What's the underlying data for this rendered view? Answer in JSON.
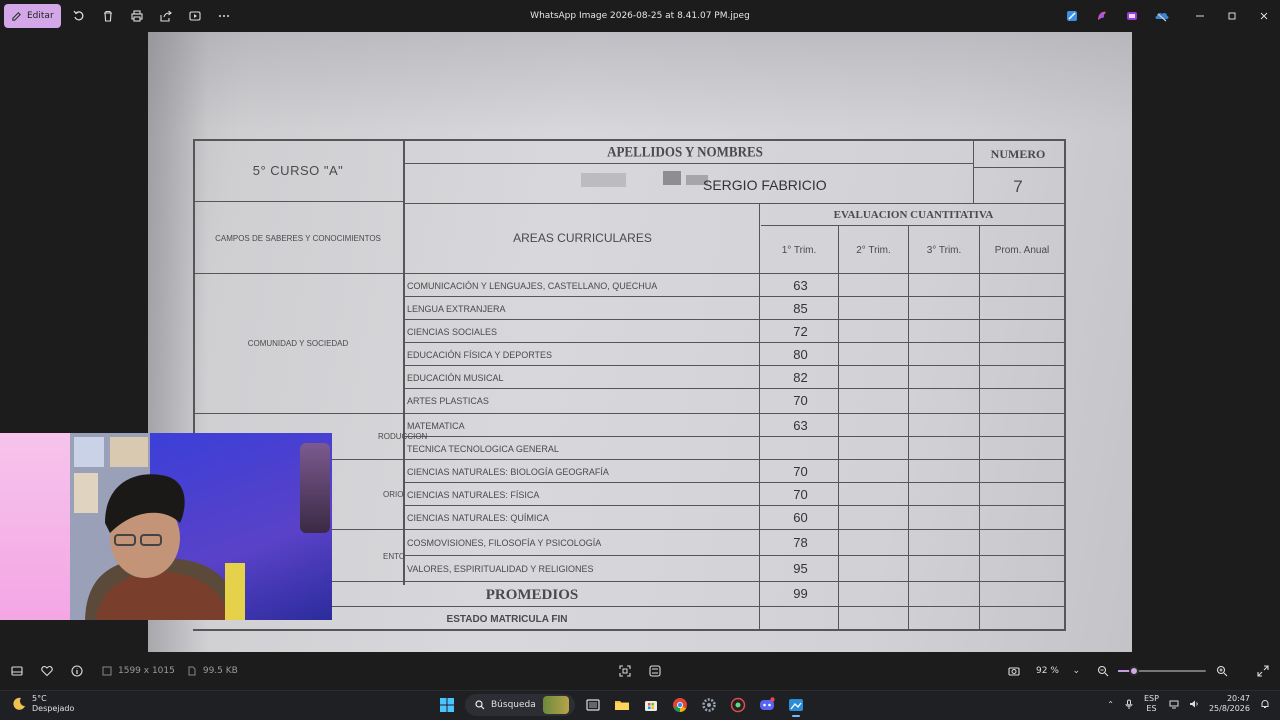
{
  "toolbar": {
    "edit_label": "Editar",
    "title": "WhatsApp Image 2026-08-25 at 8.41.07 PM.jpeg"
  },
  "document": {
    "course": "5°  CURSO  \"A\"",
    "apellidos_header": "APELLIDOS Y NOMBRES",
    "student_name": "SERGIO FABRICIO",
    "numero_header": "NUMERO",
    "numero_value": "7",
    "campos_header": "CAMPOS DE SABERES Y CONOCIMIENTOS",
    "areas_header": "AREAS CURRICULARES",
    "evaluacion_header": "EVALUACION CUANTITATIVA",
    "trimesters": [
      "1° Trim.",
      "2° Trim.",
      "3° Trim.",
      "Prom. Anual"
    ],
    "field_comunidad": "COMUNIDAD Y SOCIEDAD",
    "field_produccion_partial": "RODUCCION",
    "field_cosmos_partial": "ORIO",
    "field_vida_partial": "ENTO",
    "subjects": [
      {
        "name": "COMUNICACIÓN Y LENGUAJES, CASTELLANO, QUECHUA",
        "grade": "63"
      },
      {
        "name": "LENGUA EXTRANJERA",
        "grade": "85"
      },
      {
        "name": "CIENCIAS SOCIALES",
        "grade": "72"
      },
      {
        "name": "EDUCACIÓN FÍSICA Y DEPORTES",
        "grade": "80"
      },
      {
        "name": "EDUCACIÓN MUSICAL",
        "grade": "82"
      },
      {
        "name": "ARTES PLASTICAS",
        "grade": "70"
      },
      {
        "name": "MATEMATICA",
        "grade": "63"
      },
      {
        "name": "TECNICA TECNOLOGICA GENERAL",
        "grade": ""
      },
      {
        "name": "CIENCIAS NATURALES: BIOLOGÍA GEOGRAFÍA",
        "grade": "70"
      },
      {
        "name": "CIENCIAS NATURALES: FÍSICA",
        "grade": "70"
      },
      {
        "name": "CIENCIAS NATURALES: QUÍMICA",
        "grade": "60"
      },
      {
        "name": "COSMOVISIONES, FILOSOFÍA Y PSICOLOGÍA",
        "grade": "78"
      },
      {
        "name": "VALORES, ESPIRITUALIDAD Y RELIGIONES",
        "grade": "95"
      }
    ],
    "promedios_label": "PROMEDIOS",
    "promedios_value": "99",
    "estado_label": "ESTADO MATRICULA FIN"
  },
  "status": {
    "dimensions": "1599 x 1015",
    "size": "99.5 KB",
    "zoom": "92 %",
    "zoom_level": 0.18
  },
  "taskbar": {
    "temperature": "5°C",
    "condition": "Despejado",
    "search_placeholder": "Búsqueda",
    "lang_top": "ESP",
    "lang_bottom": "ES",
    "time": "20:47",
    "date": "25/8/2026"
  },
  "icons": [
    "edit-icon",
    "rotate-icon",
    "delete-icon",
    "print-icon",
    "share-icon",
    "slideshow-icon",
    "more-icon",
    "minimize-icon",
    "maximize-icon",
    "close-icon",
    "filmstrip-icon",
    "favorite-icon",
    "info-icon",
    "crop-icon",
    "adjust-icon",
    "zoom-out-icon",
    "zoom-in-icon",
    "fullscreen-icon",
    "windows-icon",
    "search-icon"
  ],
  "colors": {
    "accent": "#d4a8e8",
    "paper": "#d4d4d8",
    "ink": "#4a4a4c"
  }
}
